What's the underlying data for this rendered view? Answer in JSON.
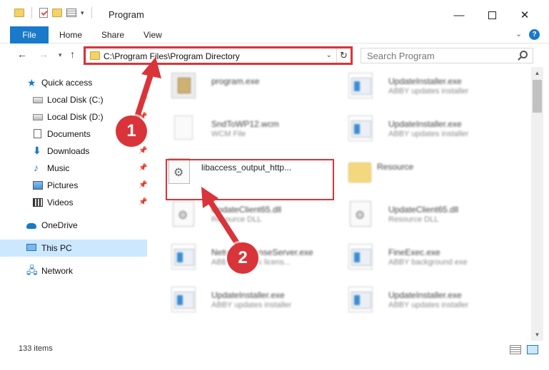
{
  "window": {
    "title": "Program",
    "minimize": "—",
    "close": "✕"
  },
  "ribbon": {
    "tabs": [
      "File",
      "Home",
      "Share",
      "View"
    ],
    "help": "?"
  },
  "nav": {
    "address": "C:\\Program Files\\Program Directory",
    "search_placeholder": "Search Program"
  },
  "sidebar": {
    "items": [
      {
        "label": "Quick access",
        "icon": "star-icon",
        "pinned": false
      },
      {
        "label": "Local Disk (C:)",
        "icon": "disk-icon",
        "pinned": true
      },
      {
        "label": "Local Disk (D:)",
        "icon": "disk-icon",
        "pinned": true
      },
      {
        "label": "Documents",
        "icon": "document-icon",
        "pinned": true
      },
      {
        "label": "Downloads",
        "icon": "download-icon",
        "pinned": true
      },
      {
        "label": "Music",
        "icon": "music-icon",
        "pinned": true
      },
      {
        "label": "Pictures",
        "icon": "pictures-icon",
        "pinned": true
      },
      {
        "label": "Videos",
        "icon": "videos-icon",
        "pinned": true
      },
      {
        "label": "OneDrive",
        "icon": "cloud-icon",
        "pinned": false
      },
      {
        "label": "This PC",
        "icon": "computer-icon",
        "pinned": false,
        "selected": true
      },
      {
        "label": "Network",
        "icon": "network-icon",
        "pinned": false
      }
    ]
  },
  "files": [
    {
      "name": "program.exe",
      "desc": "",
      "icon": "program-icon"
    },
    {
      "name": "UpdateInstaller.exe",
      "desc": "ABBY updates installer",
      "icon": "exe-icon"
    },
    {
      "name": "SndToWP12.wcm",
      "desc": "WCM File",
      "icon": "file-icon"
    },
    {
      "name": "UpdateInstaller.exe",
      "desc": "ABBY updates installer",
      "icon": "exe-icon"
    },
    {
      "name": "libaccess_output_http...",
      "desc": "",
      "icon": "dll-gear-icon"
    },
    {
      "name": "Resource",
      "desc": "",
      "icon": "folder-icon"
    },
    {
      "name": "UpdateClient65.dll",
      "desc": "Resource DLL",
      "icon": "dll-gear-icon"
    },
    {
      "name": "UpdateClient65.dll",
      "desc": "Resource DLL",
      "icon": "dll-gear-icon"
    },
    {
      "name": "NetworkLicenseServer.exe",
      "desc": "ABBY network licens...",
      "icon": "exe-icon"
    },
    {
      "name": "FineExec.exe",
      "desc": "ABBY background exe",
      "icon": "exe-icon"
    },
    {
      "name": "UpdateInstaller.exe",
      "desc": "ABBY updates installer",
      "icon": "exe-icon"
    },
    {
      "name": "UpdateInstaller.exe",
      "desc": "ABBY updates installer",
      "icon": "exe-icon"
    }
  ],
  "status": {
    "count": "133 items"
  },
  "callouts": [
    "1",
    "2"
  ],
  "colors": {
    "accent": "#1979ca",
    "highlight": "#d9343a",
    "selected": "#cce8ff"
  }
}
